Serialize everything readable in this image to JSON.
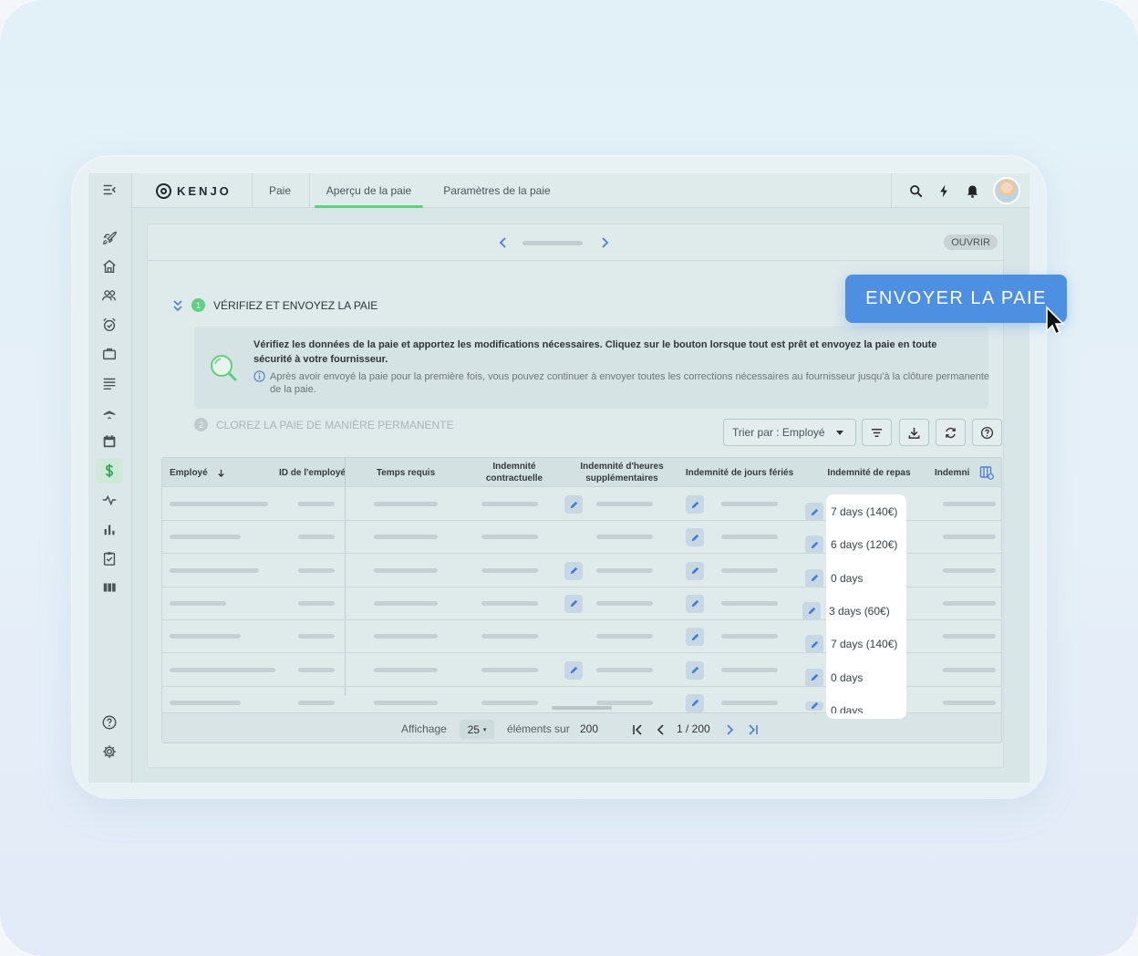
{
  "app": {
    "logo_text": "KENJO"
  },
  "tabs": [
    {
      "label": "Paie"
    },
    {
      "label": "Aperçu de la paie",
      "active": true
    },
    {
      "label": "Paramètres de la paie"
    }
  ],
  "period": {
    "status": "OUVRIR"
  },
  "steps": [
    {
      "num": "1",
      "label": "VÉRIFIEZ ET ENVOYEZ LA PAIE"
    },
    {
      "num": "2",
      "label": "CLOREZ LA PAIE DE MANIÈRE PERMANENTE"
    }
  ],
  "info": {
    "main": "Vérifiez les données de la paie et apportez les modifications nécessaires. Cliquez sur le bouton lorsque tout est prêt et envoyez la paie en toute sécurité à votre fournisseur.",
    "sub": "Après avoir envoyé la paie pour la première fois, vous pouvez continuer à envoyer toutes les corrections nécessaires au fournisseur jusqu'à la clôture permanente de la paie."
  },
  "toolbar": {
    "sort_label": "Trier par : Employé"
  },
  "table": {
    "headers": {
      "employee": "Employé",
      "employee_id": "ID de l'employé",
      "required_time": "Temps requis",
      "contract_allowance": "Indemnité\ncontractuelle",
      "overtime_allowance": "Indemnité d'heures\nsupplémentaires",
      "holiday_allowance": "Indemnité de jours fériés",
      "meal_allowance": "Indemnité de repas",
      "next_allowance": "Indemni"
    },
    "meal_values": [
      "7 days (140€)",
      "6 days (120€)",
      "0 days",
      "3 days (60€)",
      "7 days (140€)",
      "0 days",
      "0 days"
    ]
  },
  "footer": {
    "display_label": "Affichage",
    "page_size": "25",
    "items_label": "éléments sur",
    "total": "200",
    "page_indicator": "1 / 200"
  },
  "cta": {
    "label": "ENVOYER LA PAIE"
  },
  "colors": {
    "accent_green": "#5fcf80",
    "cta_blue": "#4d8fe0"
  }
}
